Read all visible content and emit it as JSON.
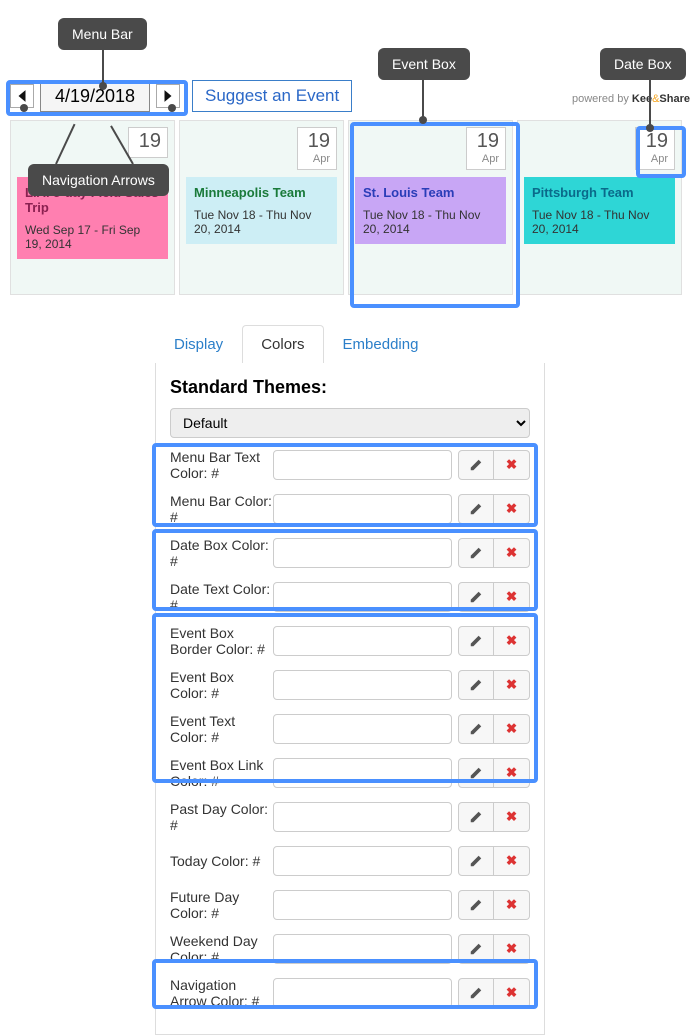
{
  "callouts": {
    "menuBar": "Menu Bar",
    "navArrows": "Navigation Arrows",
    "eventBox": "Event Box",
    "dateBox": "Date Box"
  },
  "menuBar": {
    "date": "4/19/2018",
    "suggest": "Suggest an Event",
    "poweredPrefix": "powered by",
    "brand1": "Kee",
    "brandAmp": "&",
    "brand2": "Share"
  },
  "columns": [
    {
      "dayNum": "19",
      "dayMonth": "",
      "bg": "#f0f8f5",
      "card": {
        "title": "L.A. 5-day Field Sales Trip",
        "dates": "Wed Sep 17 - Fri Sep 19, 2014",
        "bg": "#ff7fb0",
        "titleColor": "#8a2050"
      }
    },
    {
      "dayNum": "19",
      "dayMonth": "Apr",
      "bg": "#f0f8f5",
      "card": {
        "title": "Minneapolis Team",
        "dates": "Tue Nov 18 - Thu Nov 20, 2014",
        "bg": "#cdeef5",
        "titleColor": "#1a7a3a"
      }
    },
    {
      "dayNum": "19",
      "dayMonth": "Apr",
      "bg": "#f0f8f5",
      "card": {
        "title": "St. Louis Team",
        "dates": "Tue Nov 18 - Thu Nov 20, 2014",
        "bg": "#c8a6f5",
        "titleColor": "#2a3db8"
      }
    },
    {
      "dayNum": "19",
      "dayMonth": "Apr",
      "bg": "#f0f8f5",
      "card": {
        "title": "Pittsburgh Team",
        "dates": "Tue Nov 18 - Thu Nov 20, 2014",
        "bg": "#2ed6d6",
        "titleColor": "#0a6a8a"
      }
    }
  ],
  "settings": {
    "tabs": {
      "display": "Display",
      "colors": "Colors",
      "embedding": "Embedding"
    },
    "sectionTitle": "Standard Themes:",
    "themeSelected": "Default",
    "rows": [
      {
        "label": "Menu Bar Text Color: #"
      },
      {
        "label": "Menu Bar Color: #"
      },
      {
        "label": "Date Box Color: #"
      },
      {
        "label": "Date Text Color: #"
      },
      {
        "label": "Event Box Border Color: #"
      },
      {
        "label": "Event Box Color: #"
      },
      {
        "label": "Event Text Color: #"
      },
      {
        "label": "Event Box Link Color: #"
      },
      {
        "label": "Past Day Color: #"
      },
      {
        "label": "Today Color: #"
      },
      {
        "label": "Future Day Color: #"
      },
      {
        "label": "Weekend Day Color: #"
      },
      {
        "label": "Navigation Arrow Color: #"
      }
    ]
  }
}
